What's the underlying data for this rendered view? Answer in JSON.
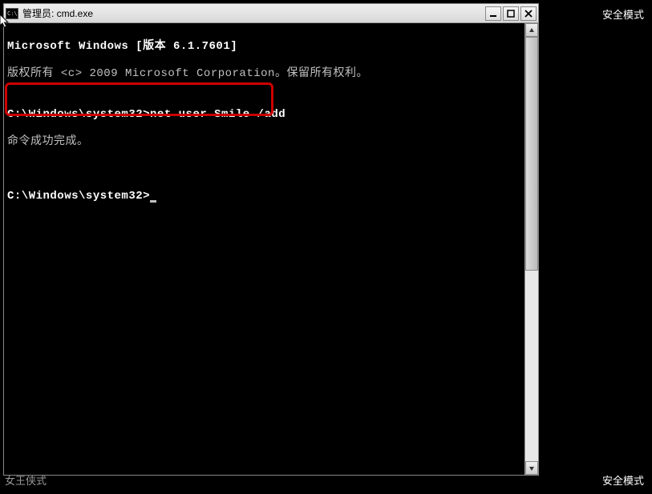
{
  "desktop": {
    "safe_mode_label": "安全模式",
    "bottom_left_partial": "女王侠式"
  },
  "window": {
    "title": "管理员: cmd.exe",
    "icon_text": "C:\\"
  },
  "terminal": {
    "line1": "Microsoft Windows [版本 6.1.7601]",
    "line2": "版权所有 <c> 2009 Microsoft Corporation。保留所有权利。",
    "line3": "",
    "prompt1_path": "C:\\Windows\\system32>",
    "prompt1_cmd": "net user Smile /add",
    "line5": "命令成功完成。",
    "line6": "",
    "line7": "",
    "prompt2_path": "C:\\Windows\\system32>"
  }
}
